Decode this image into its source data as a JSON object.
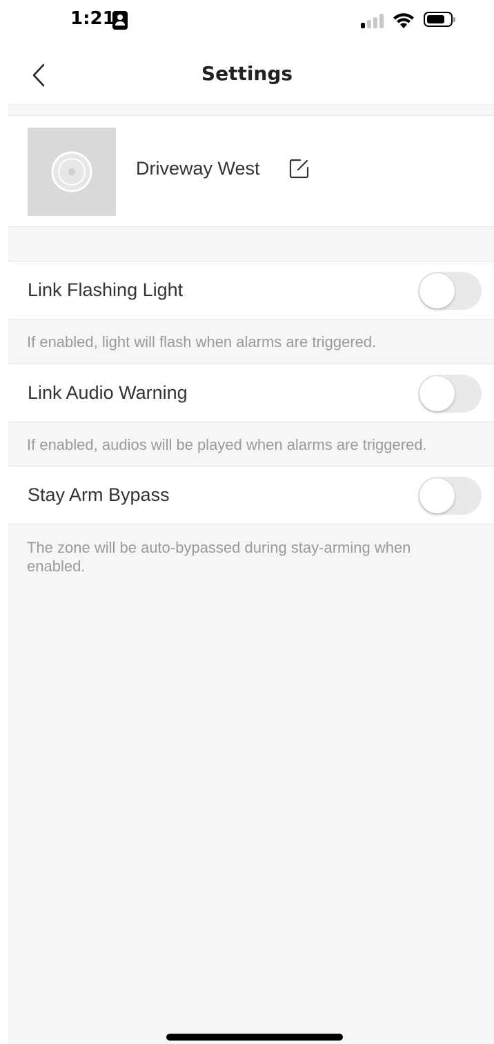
{
  "status_bar": {
    "time": "1:21",
    "icons": [
      "contact-card-icon",
      "cellular-signal-icon",
      "wifi-icon",
      "battery-icon"
    ]
  },
  "nav": {
    "title": "Settings",
    "back_icon": "chevron-left-icon"
  },
  "device": {
    "name": "Driveway West",
    "thumbnail_icon": "camera-placeholder-icon",
    "edit_icon": "edit-icon"
  },
  "settings": [
    {
      "label": "Link Flashing Light",
      "enabled": false,
      "hint": "If enabled, light will flash when alarms are triggered."
    },
    {
      "label": "Link Audio Warning",
      "enabled": false,
      "hint": "If enabled, audios will be played when alarms are triggered."
    },
    {
      "label": "Stay Arm Bypass",
      "enabled": false,
      "hint": "The zone will be auto-bypassed during stay-arming when enabled."
    }
  ],
  "colors": {
    "background": "#f6f6f6",
    "card": "#ffffff",
    "toggle_off": "#e9e9e9",
    "hint_text": "#9a9a9a"
  }
}
